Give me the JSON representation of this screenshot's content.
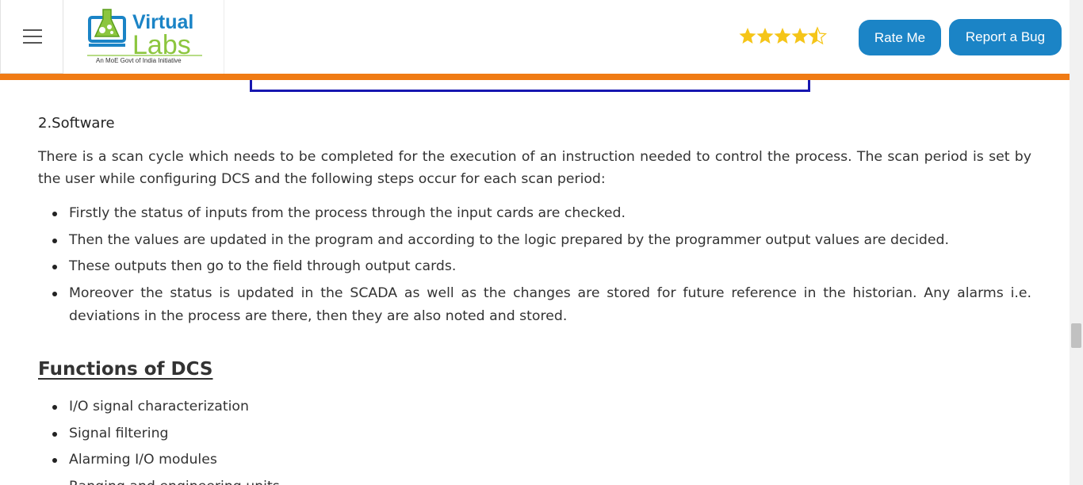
{
  "header": {
    "logo_text_top": "Virtual",
    "logo_text_bottom": "Labs",
    "logo_tagline": "An MoE Govt of India Initiative",
    "rating": 4.5,
    "rate_button": "Rate Me",
    "report_button": "Report a Bug"
  },
  "colors": {
    "accent_orange": "#f07b14",
    "button_blue": "#1b84c6",
    "star_gold": "#f5c518",
    "diagram_blue": "#1717b0"
  },
  "content": {
    "software_heading": "2.Software",
    "software_paragraph": "There is a scan cycle which needs to be completed for the execution of an instruction needed to control the process. The scan period is set by the user while configuring DCS and the following steps occur for each scan period:",
    "software_steps": [
      "Firstly the status of inputs from the process through the input cards are checked.",
      "Then the values are updated in the program and according to the logic prepared by the programmer output values are decided.",
      "These outputs then go to the field through output cards.",
      "Moreover the status is updated in the SCADA as well as the changes are stored for future reference in the historian. Any alarms i.e. deviations in the process are there, then they are also noted and stored."
    ],
    "functions_heading": "Functions of DCS",
    "functions": [
      "I/O signal characterization",
      "Signal filtering",
      "Alarming I/O modules",
      "Ranging and engineering units"
    ]
  }
}
